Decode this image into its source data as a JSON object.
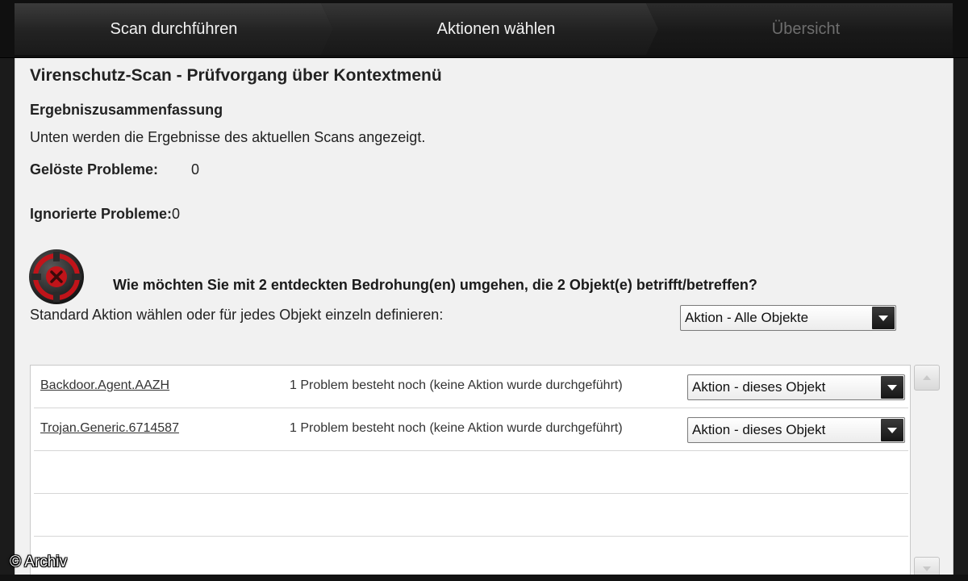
{
  "wizard": {
    "steps": [
      {
        "label": "Scan durchführen"
      },
      {
        "label": "Aktionen wählen"
      },
      {
        "label": "Übersicht"
      }
    ]
  },
  "main": {
    "title": "Virenschutz-Scan - Prüfvorgang über Kontextmenü",
    "summary": {
      "heading": "Ergebniszusammenfassung",
      "description": "Unten werden die Ergebnisse des aktuellen Scans angezeigt.",
      "resolved_label": "Gelöste Probleme:",
      "resolved_value": "0",
      "ignored_label": "Ignorierte Probleme:",
      "ignored_value": "0"
    },
    "threat_question": "Wie möchten Sie mit 2 entdeckten Bedrohung(en) umgehen, die 2 Objekt(e) betrifft/betreffen?",
    "instruction": "Standard Aktion wählen oder für jedes Objekt einzeln definieren:",
    "default_action": "Aktion - Alle Objekte",
    "threats": [
      {
        "name": "Backdoor.Agent.AAZH",
        "status": "1 Problem besteht noch (keine Aktion wurde durchgeführt)",
        "action": "Aktion - dieses Objekt"
      },
      {
        "name": "Trojan.Generic.6714587",
        "status": "1 Problem besteht noch (keine Aktion wurde durchgeführt)",
        "action": "Aktion - dieses Objekt"
      }
    ]
  },
  "watermark": "© Archiv",
  "colors": {
    "threat_red": "#c0141a",
    "step_active_text": "#f2f2f2",
    "step_inactive_text": "#6e6e6e"
  },
  "icons": {
    "threat": "threat-target-icon",
    "dropdown": "chevron-down-icon",
    "scroll_up": "arrow-up-icon",
    "scroll_down": "arrow-down-icon"
  }
}
